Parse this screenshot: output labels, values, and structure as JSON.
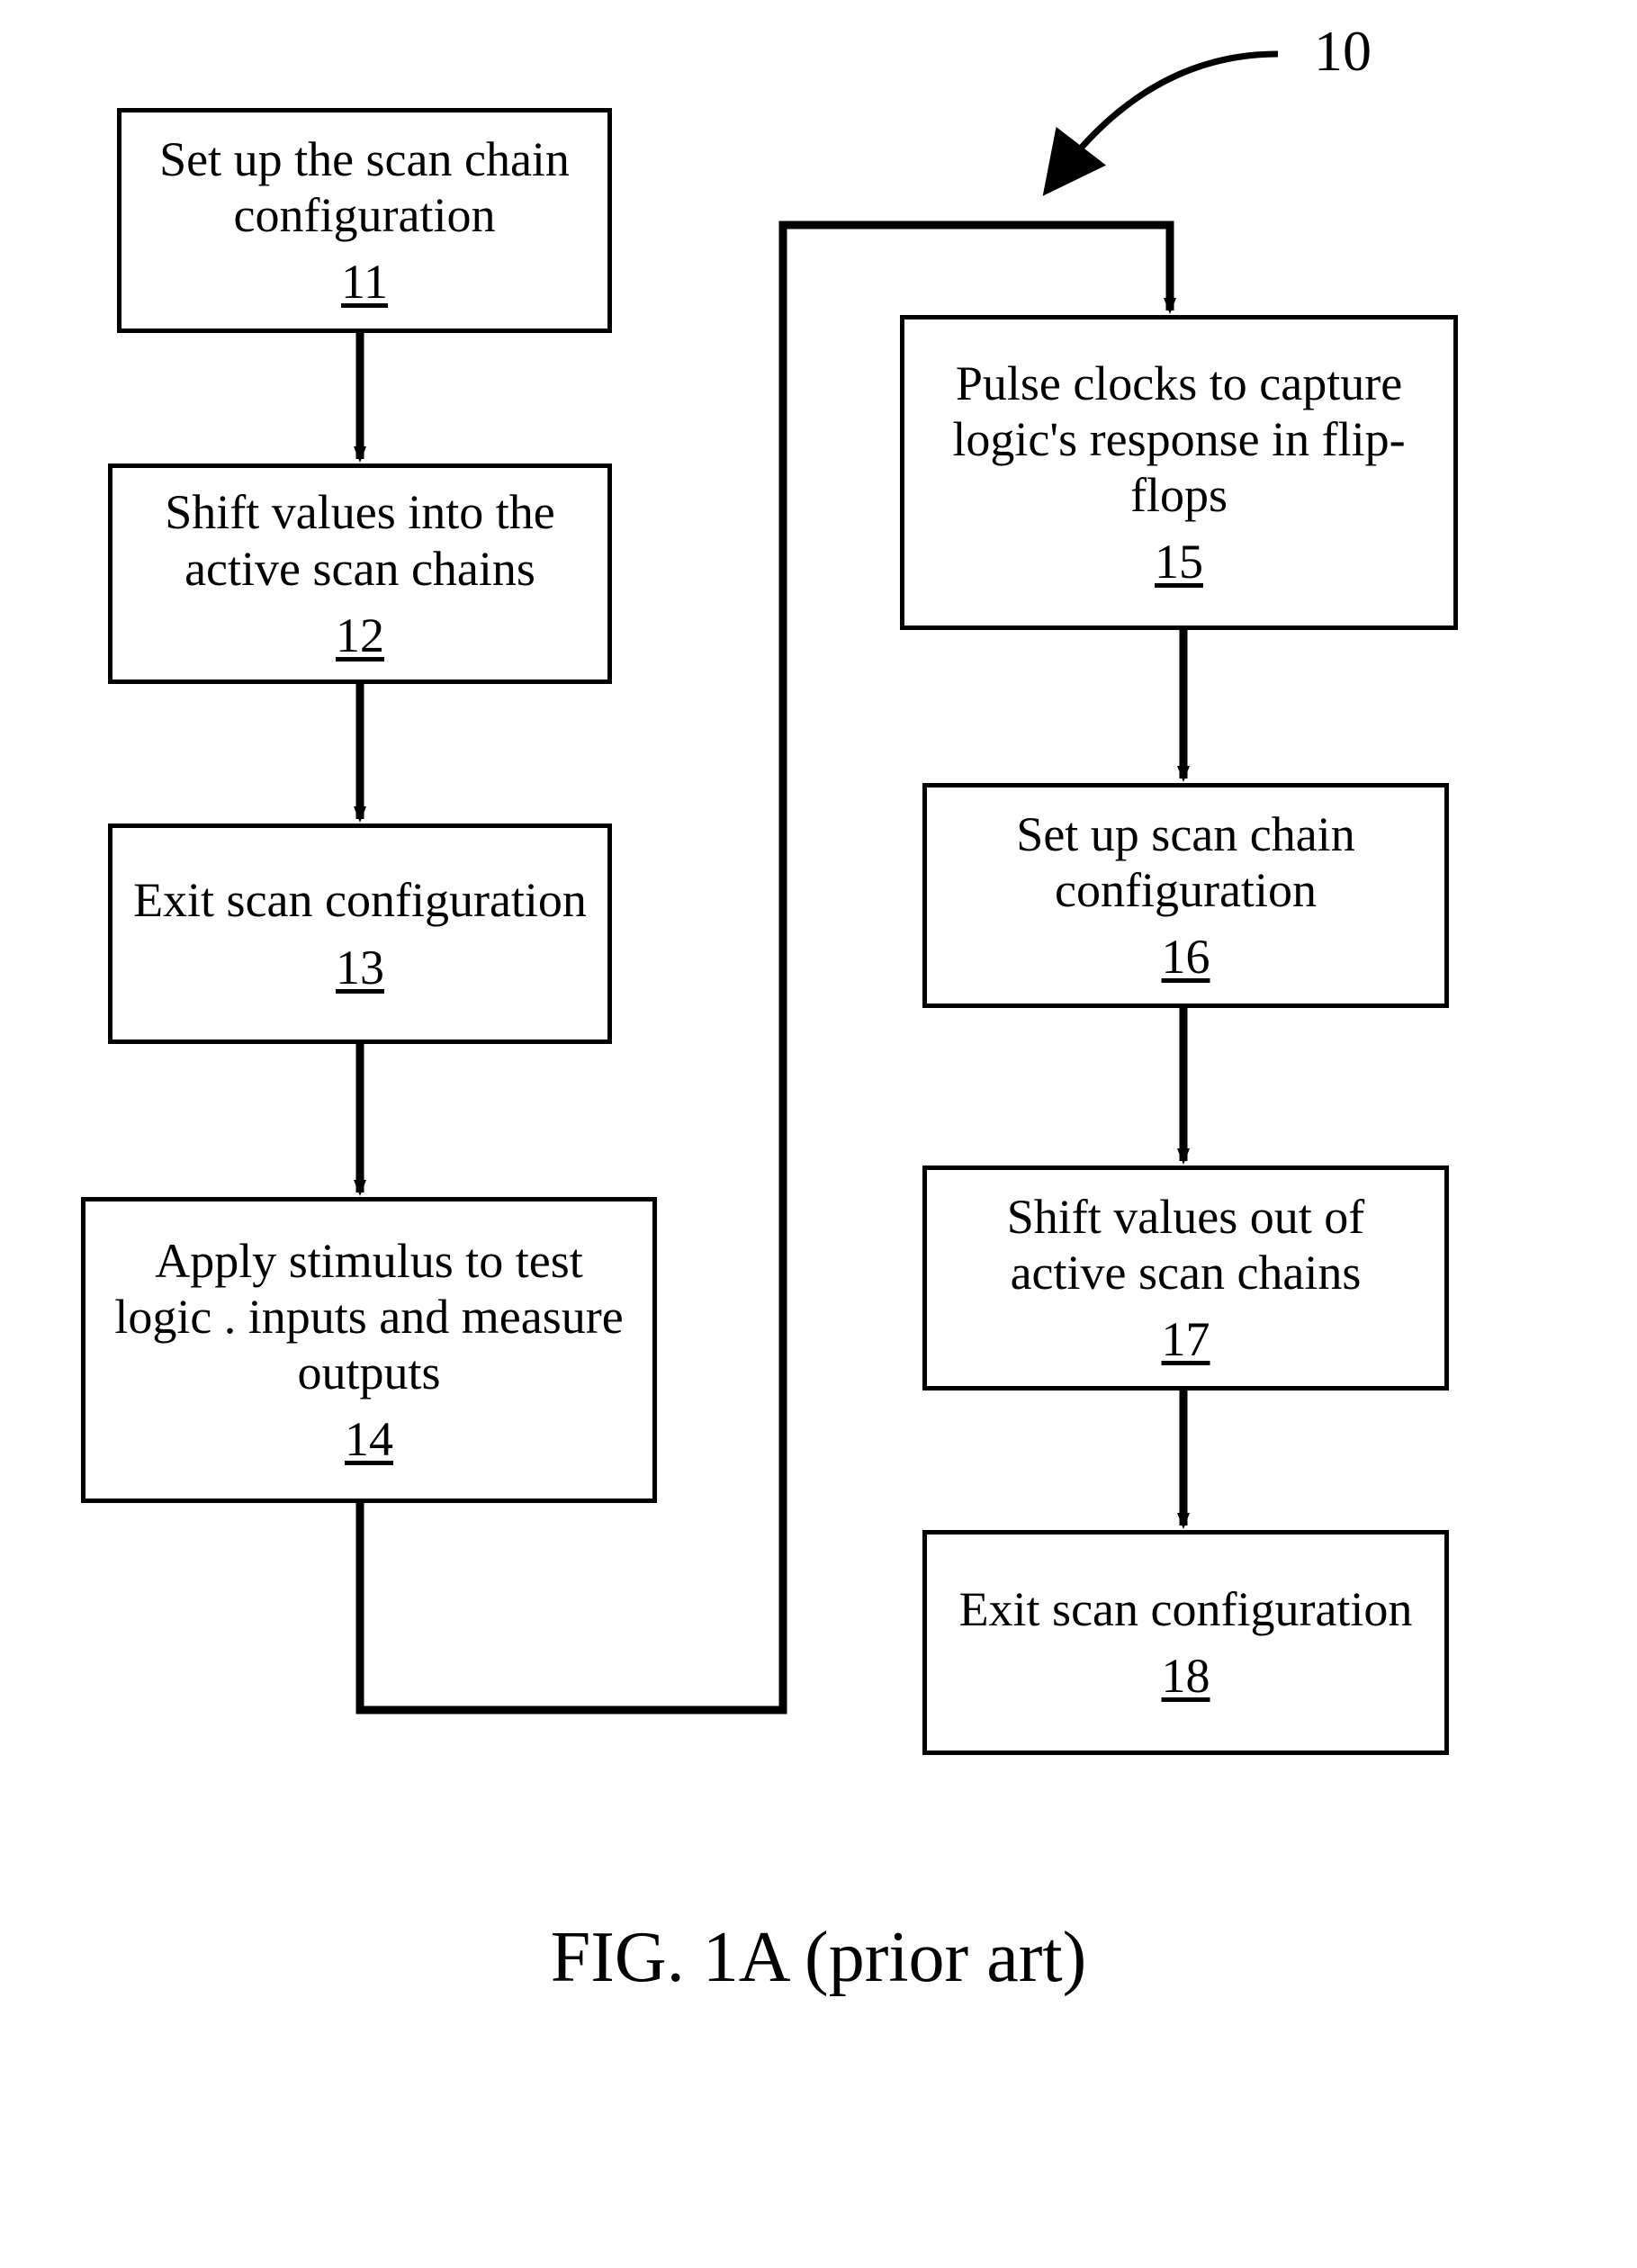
{
  "figure_label": "10",
  "caption": "FIG. 1A (prior art)",
  "boxes": {
    "11": {
      "text": "Set up the scan chain configuration",
      "num": "11"
    },
    "12": {
      "text": "Shift values into the active scan chains",
      "num": "12"
    },
    "13": {
      "text": "Exit scan configuration",
      "num": "13"
    },
    "14": {
      "text": "Apply stimulus to test logic . inputs and measure outputs",
      "num": "14"
    },
    "15": {
      "text": "Pulse clocks to capture   logic's response in flip-flops",
      "num": "15"
    },
    "16": {
      "text": "Set up scan chain configuration",
      "num": "16"
    },
    "17": {
      "text": "Shift values out of active scan chains",
      "num": "17"
    },
    "18": {
      "text": "Exit scan configuration",
      "num": "18"
    }
  },
  "chart_data": {
    "type": "flowchart",
    "nodes": [
      {
        "id": "11",
        "label": "Set up the scan chain configuration"
      },
      {
        "id": "12",
        "label": "Shift values into the active scan chains"
      },
      {
        "id": "13",
        "label": "Exit scan configuration"
      },
      {
        "id": "14",
        "label": "Apply stimulus to test logic inputs and measure outputs"
      },
      {
        "id": "15",
        "label": "Pulse clocks to capture logic's response in flip-flops"
      },
      {
        "id": "16",
        "label": "Set up scan chain configuration"
      },
      {
        "id": "17",
        "label": "Shift values out of active scan chains"
      },
      {
        "id": "18",
        "label": "Exit scan configuration"
      }
    ],
    "edges": [
      {
        "from": "11",
        "to": "12"
      },
      {
        "from": "12",
        "to": "13"
      },
      {
        "from": "13",
        "to": "14"
      },
      {
        "from": "14",
        "to": "15"
      },
      {
        "from": "15",
        "to": "16"
      },
      {
        "from": "16",
        "to": "17"
      },
      {
        "from": "17",
        "to": "18"
      }
    ],
    "reference_numeral": "10",
    "caption": "FIG. 1A (prior art)"
  }
}
